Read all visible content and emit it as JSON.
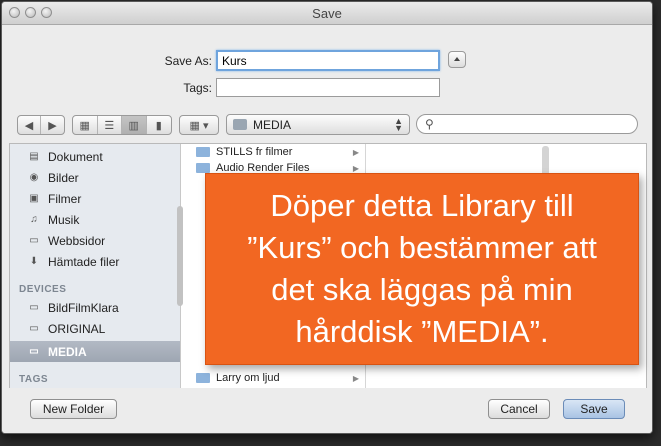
{
  "window": {
    "title": "Save"
  },
  "form": {
    "save_as_label": "Save As:",
    "save_as_value": "Kurs",
    "tags_label": "Tags:",
    "tags_value": ""
  },
  "toolbar": {
    "location": "MEDIA",
    "search_placeholder": ""
  },
  "sidebar": {
    "favorites": [
      {
        "label": "Dokument",
        "icon": "document-icon"
      },
      {
        "label": "Bilder",
        "icon": "camera-icon"
      },
      {
        "label": "Filmer",
        "icon": "film-icon"
      },
      {
        "label": "Musik",
        "icon": "music-note-icon"
      },
      {
        "label": "Webbsidor",
        "icon": "website-folder-icon"
      },
      {
        "label": "Hämtade filer",
        "icon": "download-icon"
      }
    ],
    "devices_header": "DEVICES",
    "devices": [
      {
        "label": "BildFilmKlara",
        "icon": "disk-icon"
      },
      {
        "label": "ORIGINAL",
        "icon": "disk-icon"
      },
      {
        "label": "MEDIA",
        "icon": "disk-icon",
        "selected": true
      }
    ],
    "tags_header": "TAGS"
  },
  "files": [
    {
      "name": "STILLS fr filmer"
    },
    {
      "name": "Audio Render Files"
    },
    {
      "name": "Larry om ljud"
    }
  ],
  "callout": {
    "lines": [
      "Döper detta Library till",
      "”Kurs” och bestämmer att",
      "det ska läggas på min",
      "hårddisk ”MEDIA”."
    ]
  },
  "buttons": {
    "new_folder": "New Folder",
    "cancel": "Cancel",
    "save": "Save"
  },
  "colors": {
    "callout_bg": "#f26722",
    "sidebar_selected": "#a6aeb9",
    "focus_ring": "#6fa4dd"
  }
}
